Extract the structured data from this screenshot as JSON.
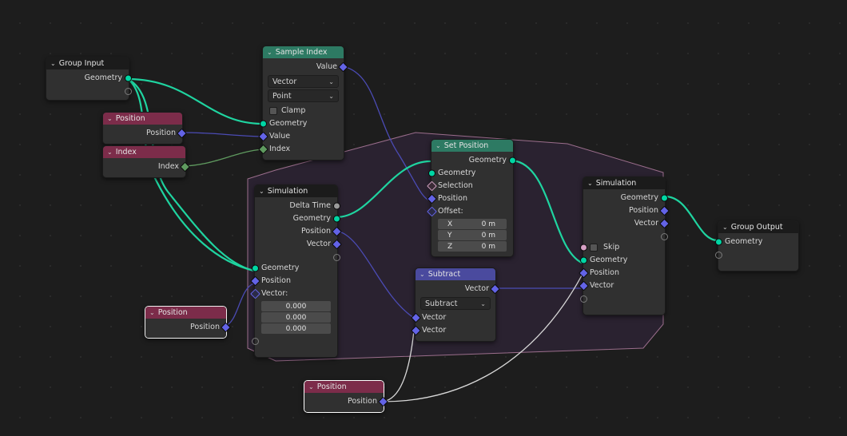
{
  "app": {
    "editor": "Geometry Node Editor",
    "background_color": "#1d1d1d"
  },
  "colors": {
    "header_geometry": "#2d7a63",
    "header_input": "#7c2c4a",
    "header_vector": "#4a4a9e",
    "header_zone": "#1b1b1b",
    "socket_geometry": "#00d6a4",
    "socket_vector": "#6363e6",
    "socket_int": "#5f9a5f",
    "socket_bool": "#d6a0c4",
    "socket_float": "#9a9a9a",
    "zone_fill": "#2a2230",
    "zone_border": "#9b6e8c",
    "link_geometry": "#1fd4a0",
    "link_vector": "#5a5ac8",
    "link_int": "#5f9a5f",
    "link_selected": "#ffffff"
  },
  "zone": {
    "name": "simulation-zone"
  },
  "nodes": [
    {
      "id": "group-input",
      "title": "Group Input",
      "header_color": "dark",
      "outputs": [
        {
          "label": "Geometry",
          "type": "geo"
        }
      ],
      "extend_socket": true
    },
    {
      "id": "position-1",
      "title": "Position",
      "header_color": "maroon",
      "outputs": [
        {
          "label": "Position",
          "type": "vec"
        }
      ]
    },
    {
      "id": "index-1",
      "title": "Index",
      "header_color": "maroon",
      "outputs": [
        {
          "label": "Index",
          "type": "intg"
        }
      ]
    },
    {
      "id": "sample-index",
      "title": "Sample Index",
      "header_color": "green",
      "outputs": [
        {
          "label": "Value",
          "type": "vec"
        }
      ],
      "dropdowns": [
        {
          "label": "Vector",
          "name": "data-type-dropdown"
        },
        {
          "label": "Point",
          "name": "domain-dropdown"
        }
      ],
      "checkbox": {
        "label": "Clamp",
        "checked": false
      },
      "inputs": [
        {
          "label": "Geometry",
          "type": "geo"
        },
        {
          "label": "Value",
          "type": "vec"
        },
        {
          "label": "Index",
          "type": "intg"
        }
      ]
    },
    {
      "id": "simulation-input",
      "title": "Simulation",
      "header_color": "dark",
      "outputs": [
        {
          "label": "Delta Time",
          "type": "grey"
        },
        {
          "label": "Geometry",
          "type": "geo"
        },
        {
          "label": "Position",
          "type": "vec"
        },
        {
          "label": "Vector",
          "type": "vec"
        }
      ],
      "extend_socket_out": true,
      "inputs": [
        {
          "label": "Geometry",
          "type": "geo"
        },
        {
          "label": "Position",
          "type": "vec"
        },
        {
          "label": "Vector:",
          "type": "vech"
        }
      ],
      "vector_values": [
        "0.000",
        "0.000",
        "0.000"
      ],
      "extend_socket_in": true
    },
    {
      "id": "set-position",
      "title": "Set Position",
      "header_color": "green",
      "outputs": [
        {
          "label": "Geometry",
          "type": "geo"
        }
      ],
      "inputs": [
        {
          "label": "Geometry",
          "type": "geo"
        },
        {
          "label": "Selection",
          "type": "selh"
        },
        {
          "label": "Position",
          "type": "vec"
        },
        {
          "label": "Offset:",
          "type": "vech"
        }
      ],
      "offset": [
        {
          "axis": "X",
          "value": "0 m"
        },
        {
          "axis": "Y",
          "value": "0 m"
        },
        {
          "axis": "Z",
          "value": "0 m"
        }
      ]
    },
    {
      "id": "subtract",
      "title": "Subtract",
      "header_color": "blue",
      "outputs": [
        {
          "label": "Vector",
          "type": "vec"
        }
      ],
      "dropdowns": [
        {
          "label": "Subtract",
          "name": "operation-dropdown"
        }
      ],
      "inputs": [
        {
          "label": "Vector",
          "type": "vec"
        },
        {
          "label": "Vector",
          "type": "vec"
        }
      ]
    },
    {
      "id": "position-2",
      "title": "Position",
      "header_color": "maroon",
      "selected": true,
      "outputs": [
        {
          "label": "Position",
          "type": "vec"
        }
      ]
    },
    {
      "id": "simulation-output",
      "title": "Simulation",
      "header_color": "dark",
      "outputs": [
        {
          "label": "Geometry",
          "type": "geo"
        },
        {
          "label": "Position",
          "type": "vec"
        },
        {
          "label": "Vector",
          "type": "vec"
        }
      ],
      "extend_socket_out": true,
      "checkbox_input": {
        "label": "Skip",
        "checked": false,
        "type": "pink"
      },
      "inputs": [
        {
          "label": "Geometry",
          "type": "geo"
        },
        {
          "label": "Position",
          "type": "vec"
        },
        {
          "label": "Vector",
          "type": "vec"
        }
      ],
      "extend_socket_in": true
    },
    {
      "id": "position-3",
      "title": "Position",
      "header_color": "maroon",
      "active": true,
      "outputs": [
        {
          "label": "Position",
          "type": "vec"
        }
      ]
    },
    {
      "id": "group-output",
      "title": "Group Output",
      "header_color": "dark",
      "inputs": [
        {
          "label": "Geometry",
          "type": "geo"
        }
      ],
      "extend_socket": true
    }
  ]
}
